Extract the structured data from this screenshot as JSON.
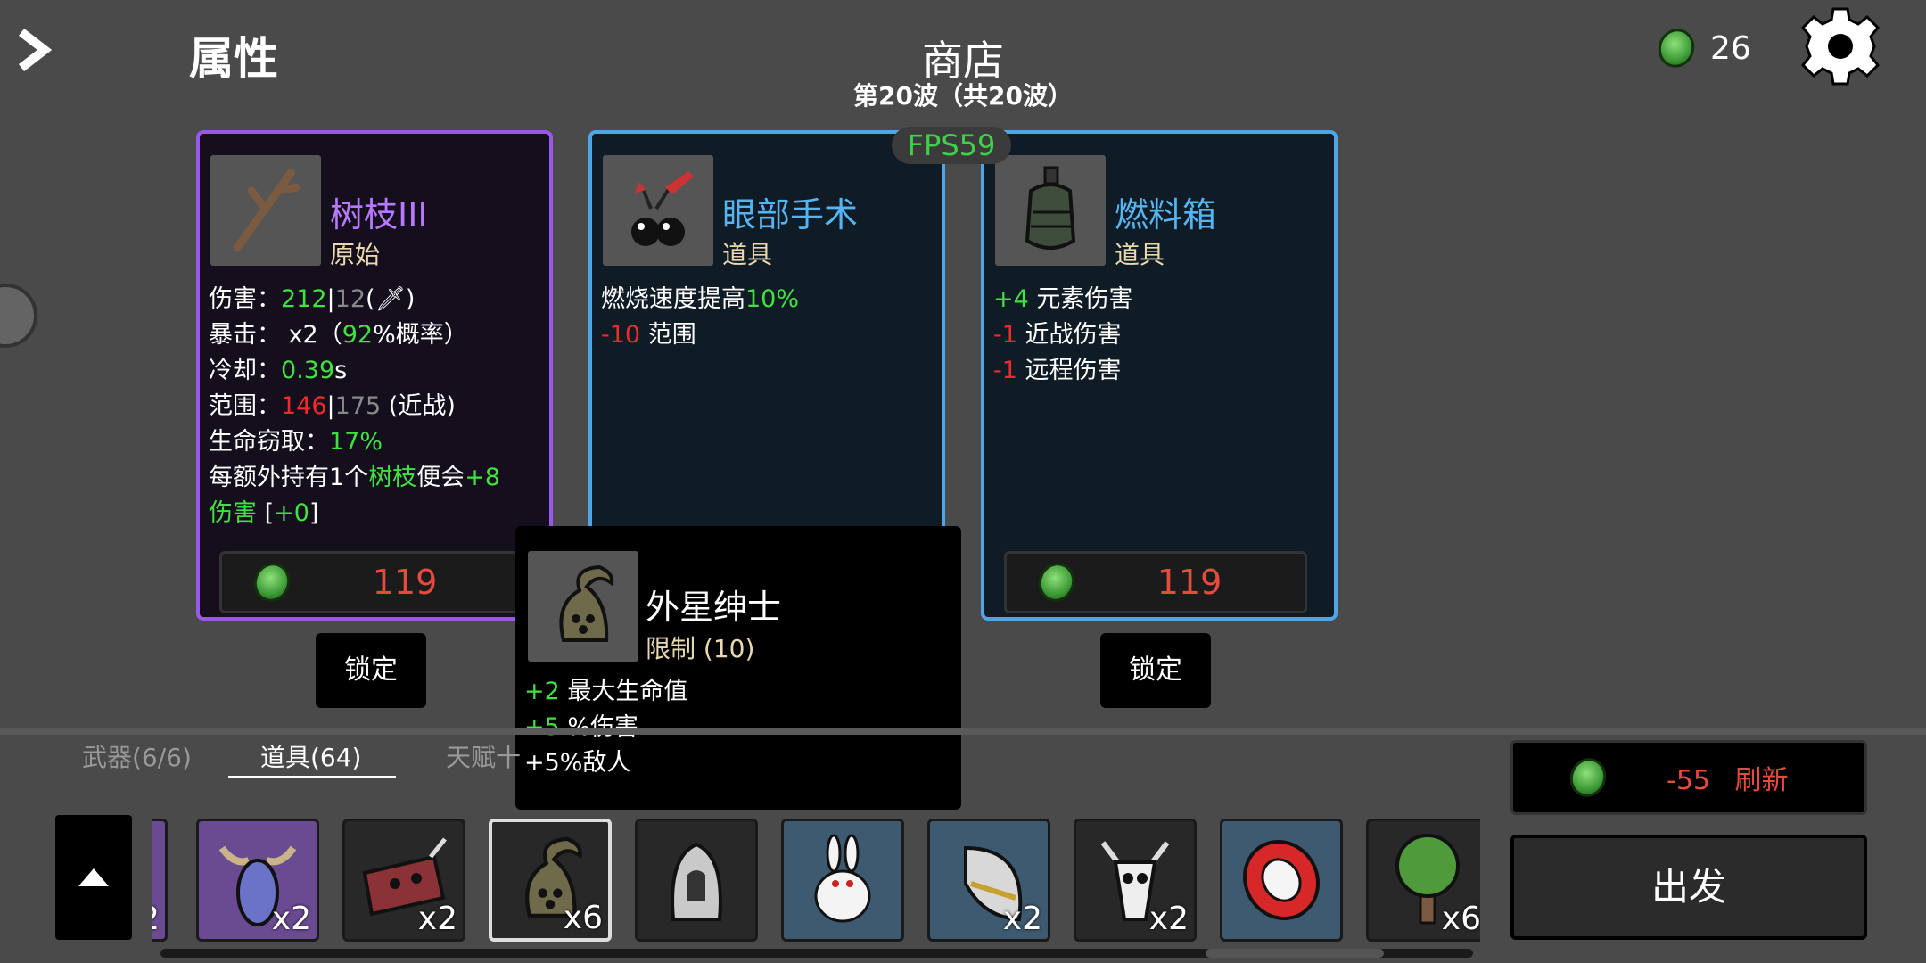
{
  "header": {
    "attributes_label": "属性",
    "shop_title": "商店",
    "wave_text": "第20波（共20波）",
    "gold": "26",
    "fps": "FPS59"
  },
  "cards": [
    {
      "name": "树枝III",
      "type": "原始",
      "price": "119",
      "lock_label": "锁定"
    },
    {
      "name": "眼部手术",
      "type": "道具"
    },
    {
      "name": "燃料箱",
      "type": "道具",
      "price": "119",
      "lock_label": "锁定"
    }
  ],
  "card1_stats": {
    "damage_label": "伤害：",
    "damage": "212",
    "damage_base": "12",
    "crit_label": "暴击： x2（",
    "crit_pct": "92",
    "crit_suffix": "%概率）",
    "cooldown_label": "冷却：",
    "cooldown": "0.39",
    "cooldown_unit": "s",
    "range_label": "范围：",
    "range": "146",
    "range_base": "175",
    "range_suffix": " (近战)",
    "lifesteal_label": "生命窃取：",
    "lifesteal": "17%",
    "bonus_a": "每额外持有1个",
    "bonus_item": "树枝",
    "bonus_b": "便会",
    "bonus_val": "+8",
    "bonus_dmg": "伤害",
    "bonus_extra": "+0"
  },
  "card2_stats": {
    "l1a": "燃烧速度提高",
    "l1b": "10%",
    "l2a": "-10",
    "l2b": " 范围"
  },
  "card3_stats": {
    "l1a": "+4",
    "l1b": " 元素伤害",
    "l2a": "-1",
    "l2b": " 近战伤害",
    "l3a": "-1",
    "l3b": " 远程伤害"
  },
  "tooltip": {
    "name": "外星绅士",
    "limit": "限制 (10)",
    "l1a": "+2",
    "l1b": " 最大生命值",
    "l2a": "+5",
    "l2b": " %伤害",
    "l3": "+5%敌人"
  },
  "tabs": {
    "weapons": "武器(6/6)",
    "items": "道具(64)",
    "talents": "天赋十"
  },
  "refresh": {
    "cost": "-55",
    "label": "刷新"
  },
  "go_label": "出发",
  "inventory": [
    {
      "icon": "partial-item-icon",
      "count": "2"
    },
    {
      "icon": "horned-bug-icon",
      "count": "x2"
    },
    {
      "icon": "red-mask-icon",
      "count": "x2"
    },
    {
      "icon": "alien-gentleman-icon",
      "count": "x6"
    },
    {
      "icon": "hooded-figure-icon",
      "count": ""
    },
    {
      "icon": "rabbit-icon",
      "count": ""
    },
    {
      "icon": "helmet-visor-icon",
      "count": "x2"
    },
    {
      "icon": "skull-icon",
      "count": "x2"
    },
    {
      "icon": "red-disc-icon",
      "count": ""
    },
    {
      "icon": "tree-icon",
      "count": "x6"
    }
  ]
}
